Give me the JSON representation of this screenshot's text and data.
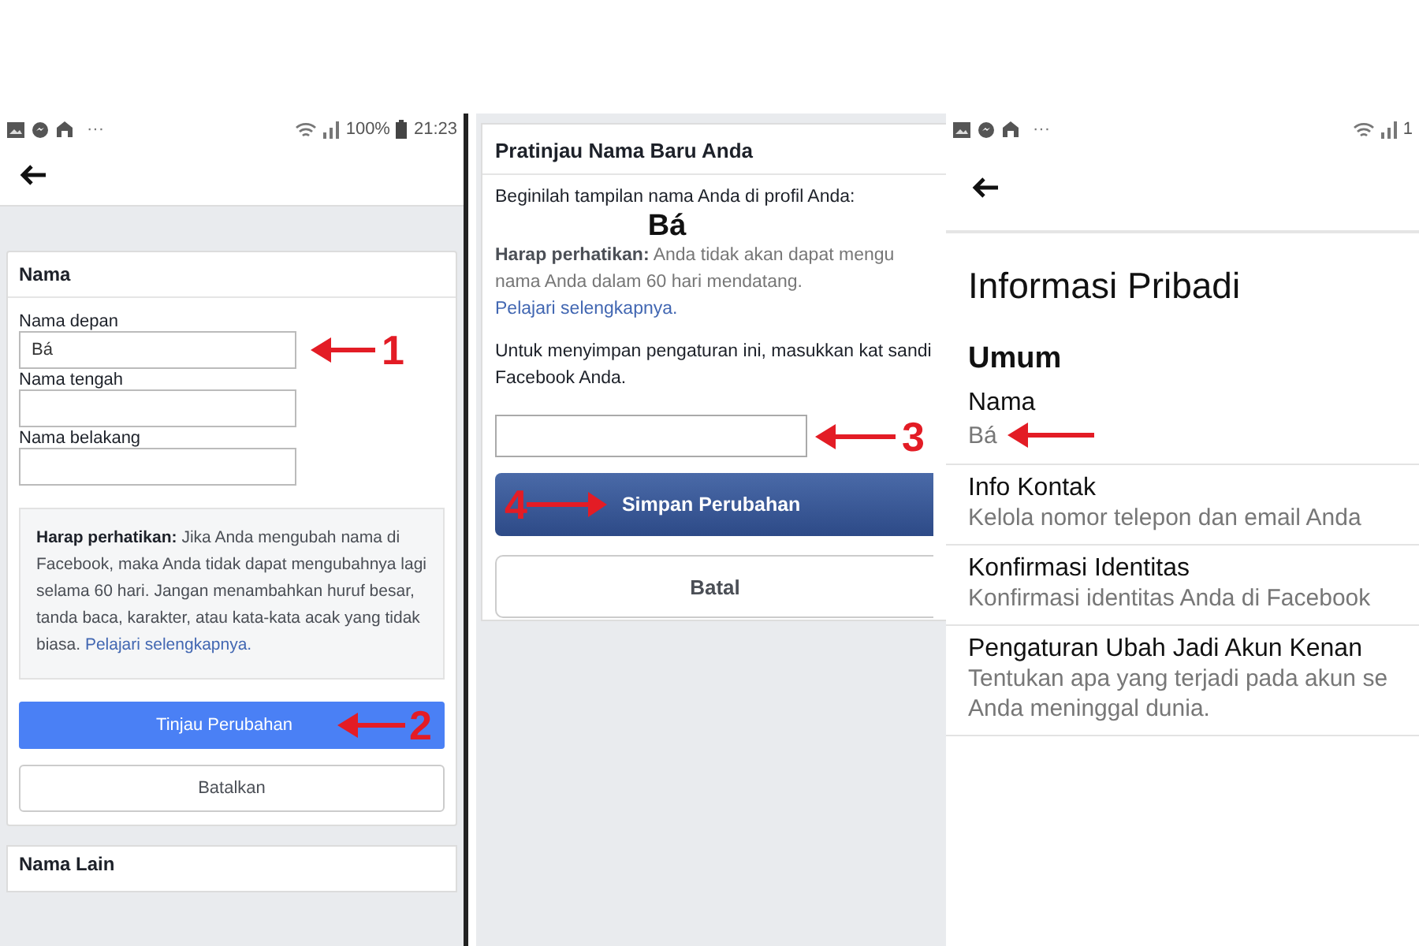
{
  "edit_name": {
    "status_bar": {
      "dots": "···",
      "battery": "100%",
      "time": "21:23"
    },
    "section_title": "Nama",
    "fields": [
      {
        "label": "Nama depan",
        "value": "Bá",
        "step": "1"
      },
      {
        "label": "Nama tengah"
      },
      {
        "label": "Nama belakang"
      }
    ],
    "note": "**Harap perhatikan:** Jika Anda mengubah nama di Facebook, maka Anda tidak dapat mengubahnya lagi selama 60 hari. Jangan menambahkan huruf besar, tanda baca, karakter, atau kata-kata acak yang tidak biasa.",
    "note_link": "Pelajari selengkapnya.",
    "primary_button": {
      "label": "Tinjau Perubahan",
      "step": "2"
    },
    "cancel_button": "Batalkan",
    "next_section_title": "Nama Lain"
  },
  "preview": {
    "title": "Pratinjau Nama Baru Anda",
    "intro": "Beginilah tampilan nama Anda di profil Anda:",
    "name": "Bá",
    "notice": "**Harap perhatikan:** Anda tidak akan dapat mengu nama Anda dalam 60 hari mendatang.",
    "notice_link": "Pelajari selengkapnya.",
    "password_prompt": "Untuk menyimpan pengaturan ini, masukkan kat sandi Facebook Anda.",
    "password_step": "3",
    "save_button": {
      "label": "Simpan Perubahan",
      "step": "4"
    },
    "cancel_button": "Batal"
  },
  "profile": {
    "status_bar": {
      "dots": "···",
      "battery": "1"
    },
    "title": "Informasi Pribadi",
    "section": "Umum",
    "items": [
      {
        "title": "Nama",
        "subtitle": "Bá",
        "marked": true
      },
      {
        "title": "Info Kontak",
        "subtitle": "Kelola nomor telepon dan email Anda",
        "marked": false
      },
      {
        "title": "Konfirmasi Identitas",
        "subtitle": "Konfirmasi identitas Anda di Facebook",
        "marked": false
      },
      {
        "title": "Pengaturan Ubah Jadi Akun Kenan",
        "subtitle": "Tentukan apa yang terjadi pada akun se Anda meninggal dunia.",
        "marked": false
      }
    ]
  }
}
